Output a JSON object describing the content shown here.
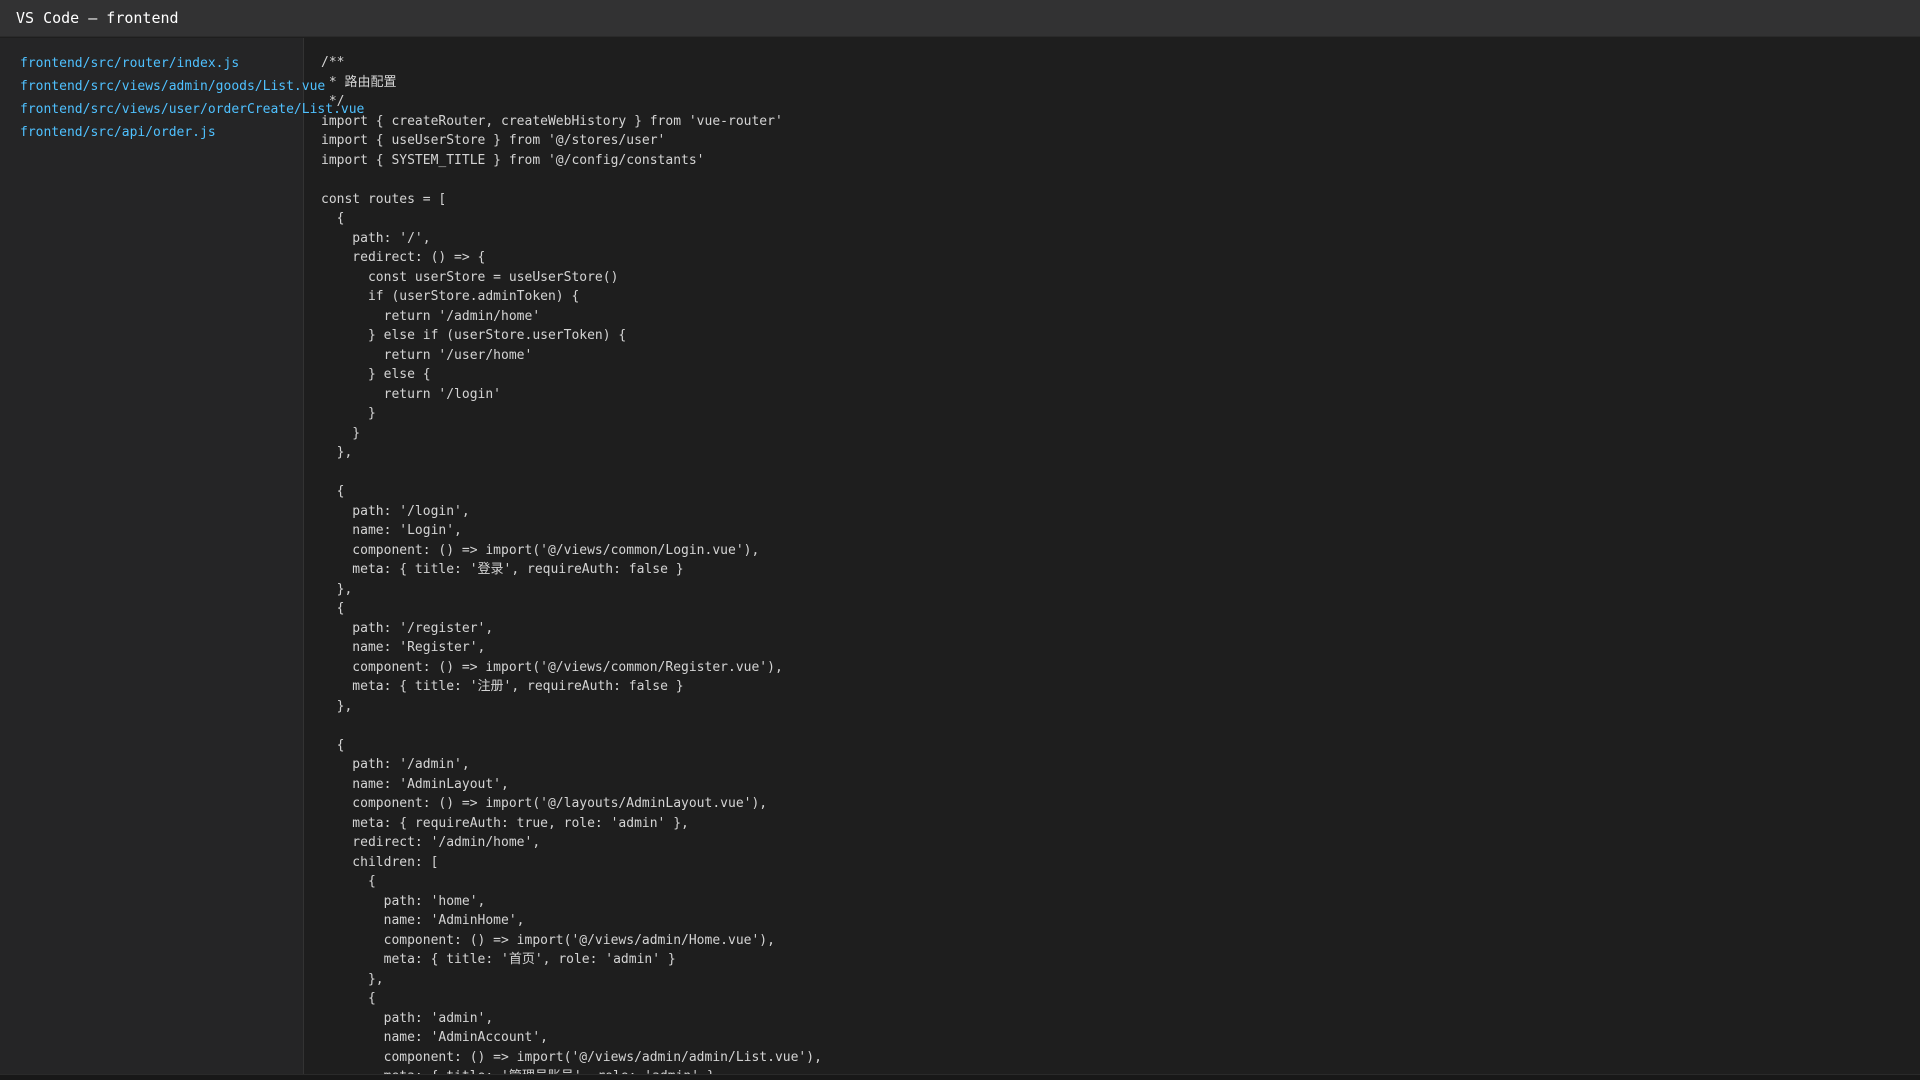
{
  "window": {
    "title": "VS Code — frontend"
  },
  "sidebar": {
    "files": [
      "frontend/src/router/index.js",
      "frontend/src/views/admin/goods/List.vue",
      "frontend/src/views/user/orderCreate/List.vue",
      "frontend/src/api/order.js"
    ]
  },
  "editor": {
    "lines": [
      "/**",
      " * 路由配置",
      " */",
      "import { createRouter, createWebHistory } from 'vue-router'",
      "import { useUserStore } from '@/stores/user'",
      "import { SYSTEM_TITLE } from '@/config/constants'",
      "",
      "const routes = [",
      "  {",
      "    path: '/',",
      "    redirect: () => {",
      "      const userStore = useUserStore()",
      "      if (userStore.adminToken) {",
      "        return '/admin/home'",
      "      } else if (userStore.userToken) {",
      "        return '/user/home'",
      "      } else {",
      "        return '/login'",
      "      }",
      "    }",
      "  },",
      "",
      "  {",
      "    path: '/login',",
      "    name: 'Login',",
      "    component: () => import('@/views/common/Login.vue'),",
      "    meta: { title: '登录', requireAuth: false }",
      "  },",
      "  {",
      "    path: '/register',",
      "    name: 'Register',",
      "    component: () => import('@/views/common/Register.vue'),",
      "    meta: { title: '注册', requireAuth: false }",
      "  },",
      "",
      "  {",
      "    path: '/admin',",
      "    name: 'AdminLayout',",
      "    component: () => import('@/layouts/AdminLayout.vue'),",
      "    meta: { requireAuth: true, role: 'admin' },",
      "    redirect: '/admin/home',",
      "    children: [",
      "      {",
      "        path: 'home',",
      "        name: 'AdminHome',",
      "        component: () => import('@/views/admin/Home.vue'),",
      "        meta: { title: '首页', role: 'admin' }",
      "      },",
      "      {",
      "        path: 'admin',",
      "        name: 'AdminAccount',",
      "        component: () => import('@/views/admin/admin/List.vue'),",
      "        meta: { title: '管理员账号', role: 'admin' }"
    ]
  }
}
